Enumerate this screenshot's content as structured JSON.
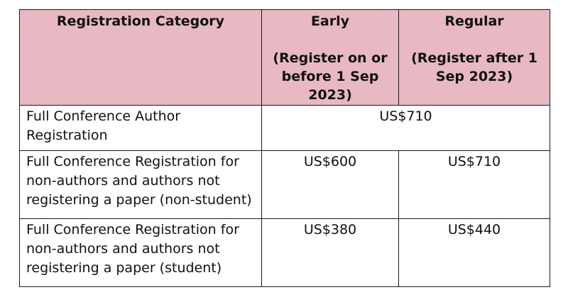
{
  "table": {
    "headers": {
      "category": "Registration Category",
      "early": "Early",
      "early_note": "(Register on or before 1 Sep 2023)",
      "regular": "Regular",
      "regular_note": "(Register after 1 Sep 2023)"
    },
    "rows": [
      {
        "category": "Full Conference Author Registration",
        "price": "US$710"
      },
      {
        "category": "Full Conference Registration for non-authors and authors not registering a paper (non-student)",
        "early": "US$600",
        "regular": "US$710"
      },
      {
        "category": "Full Conference Registration for non-authors and authors not registering a paper (student)",
        "early": "US$380",
        "regular": "US$440"
      }
    ],
    "colors": {
      "header_background": "#e8b9c2",
      "border": "#1a1a1a"
    }
  }
}
